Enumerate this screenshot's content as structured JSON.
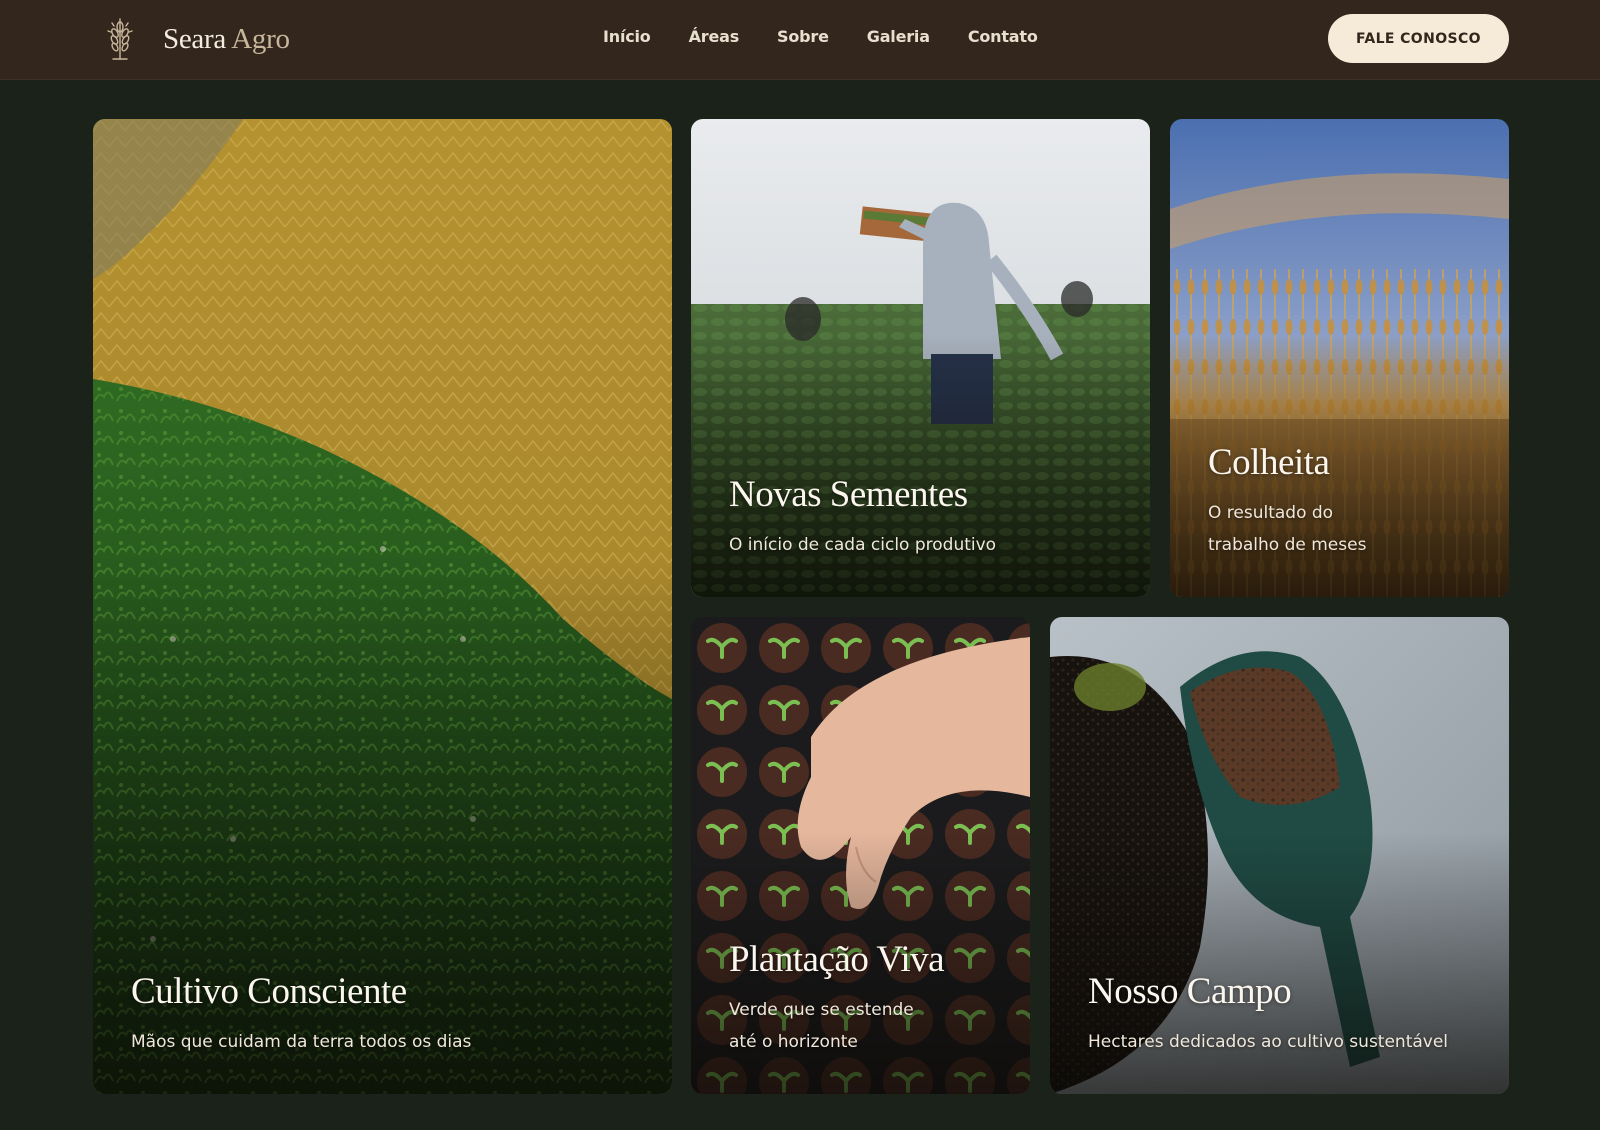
{
  "header": {
    "brand_main": "Seara",
    "brand_accent": "Agro",
    "logo_icon": "wheat-icon",
    "nav": [
      "Início",
      "Áreas",
      "Sobre",
      "Galeria",
      "Contato"
    ],
    "cta_label": "FALE CONOSCO"
  },
  "colors": {
    "header_bg": "#33261d",
    "page_bg": "#1b2219",
    "cta_bg": "#f5ebd8",
    "cta_text": "#33261d"
  },
  "gallery": [
    {
      "title": "Cultivo Consciente",
      "subtitle": "Mãos que cuidam da terra todos os dias"
    },
    {
      "title": "Novas Sementes",
      "subtitle": "O início de cada ciclo produtivo"
    },
    {
      "title": "Colheita",
      "subtitle": "O resultado do trabalho de meses"
    },
    {
      "title": "Plantação Viva",
      "subtitle": "Verde que se estende até o horizonte"
    },
    {
      "title": "Nosso Campo",
      "subtitle": "Hectares dedicados ao cultivo sustentável"
    }
  ]
}
